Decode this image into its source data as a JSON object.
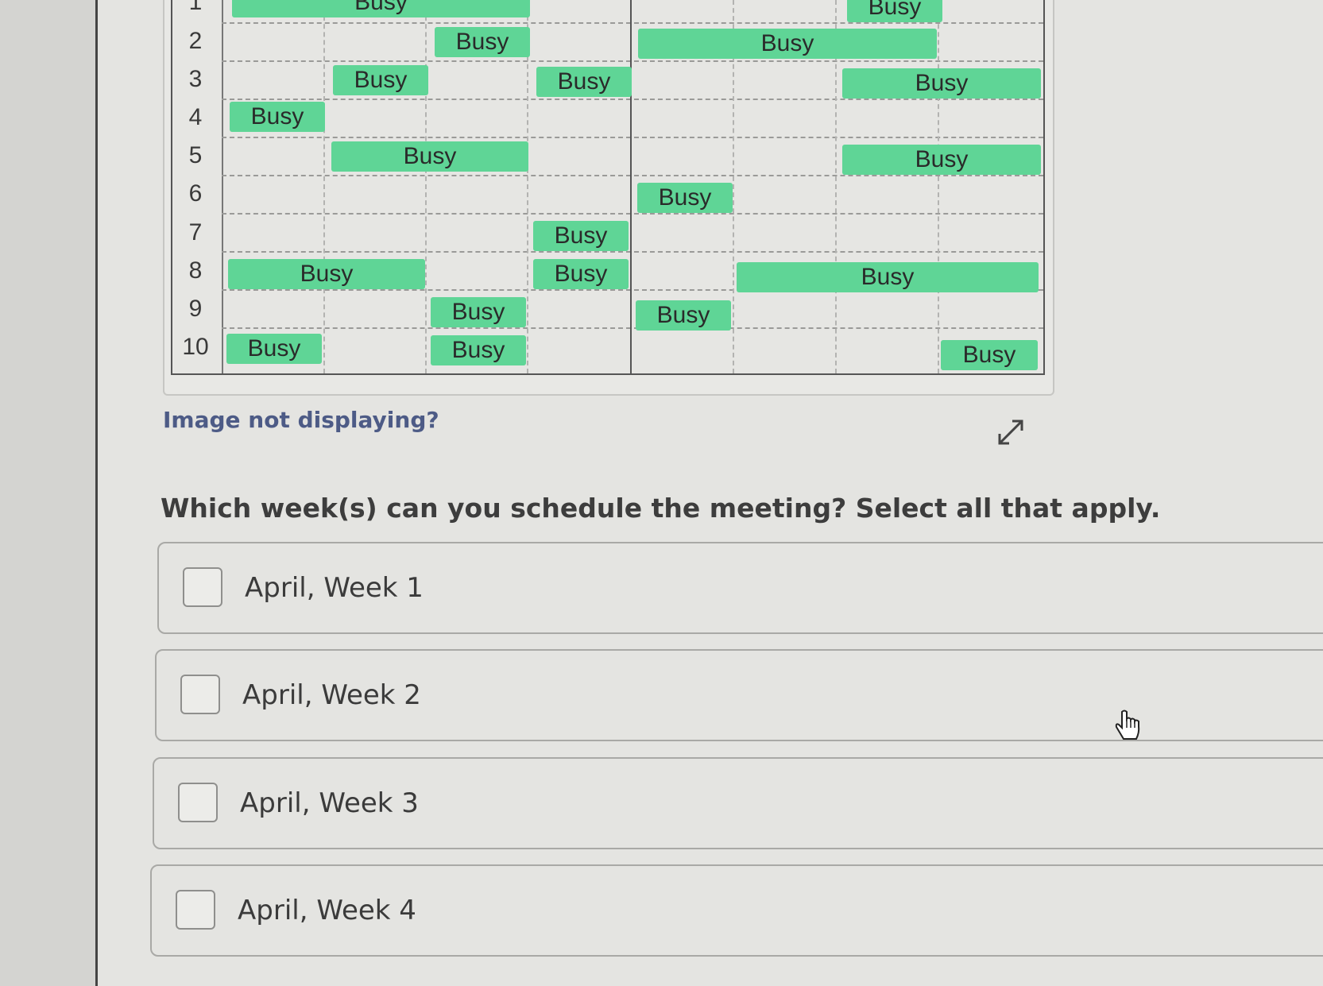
{
  "schedule": {
    "row_labels": [
      "1",
      "2",
      "3",
      "4",
      "5",
      "6",
      "7",
      "8",
      "9",
      "10"
    ],
    "busy_label": "Busy"
  },
  "image_help": {
    "label": "Image not displaying?"
  },
  "question": {
    "text": "Which week(s) can you schedule the meeting? Select all that apply."
  },
  "options": [
    {
      "label": "April, Week 1",
      "checked": false
    },
    {
      "label": "April, Week 2",
      "checked": false
    },
    {
      "label": "April, Week 3",
      "checked": false
    },
    {
      "label": "April, Week 4",
      "checked": false
    }
  ],
  "icons": {
    "expand": "expand-arrows-icon",
    "cursor": "hand-pointer-icon"
  },
  "colors": {
    "busy": "#5fd596",
    "link": "#4d5b86"
  }
}
